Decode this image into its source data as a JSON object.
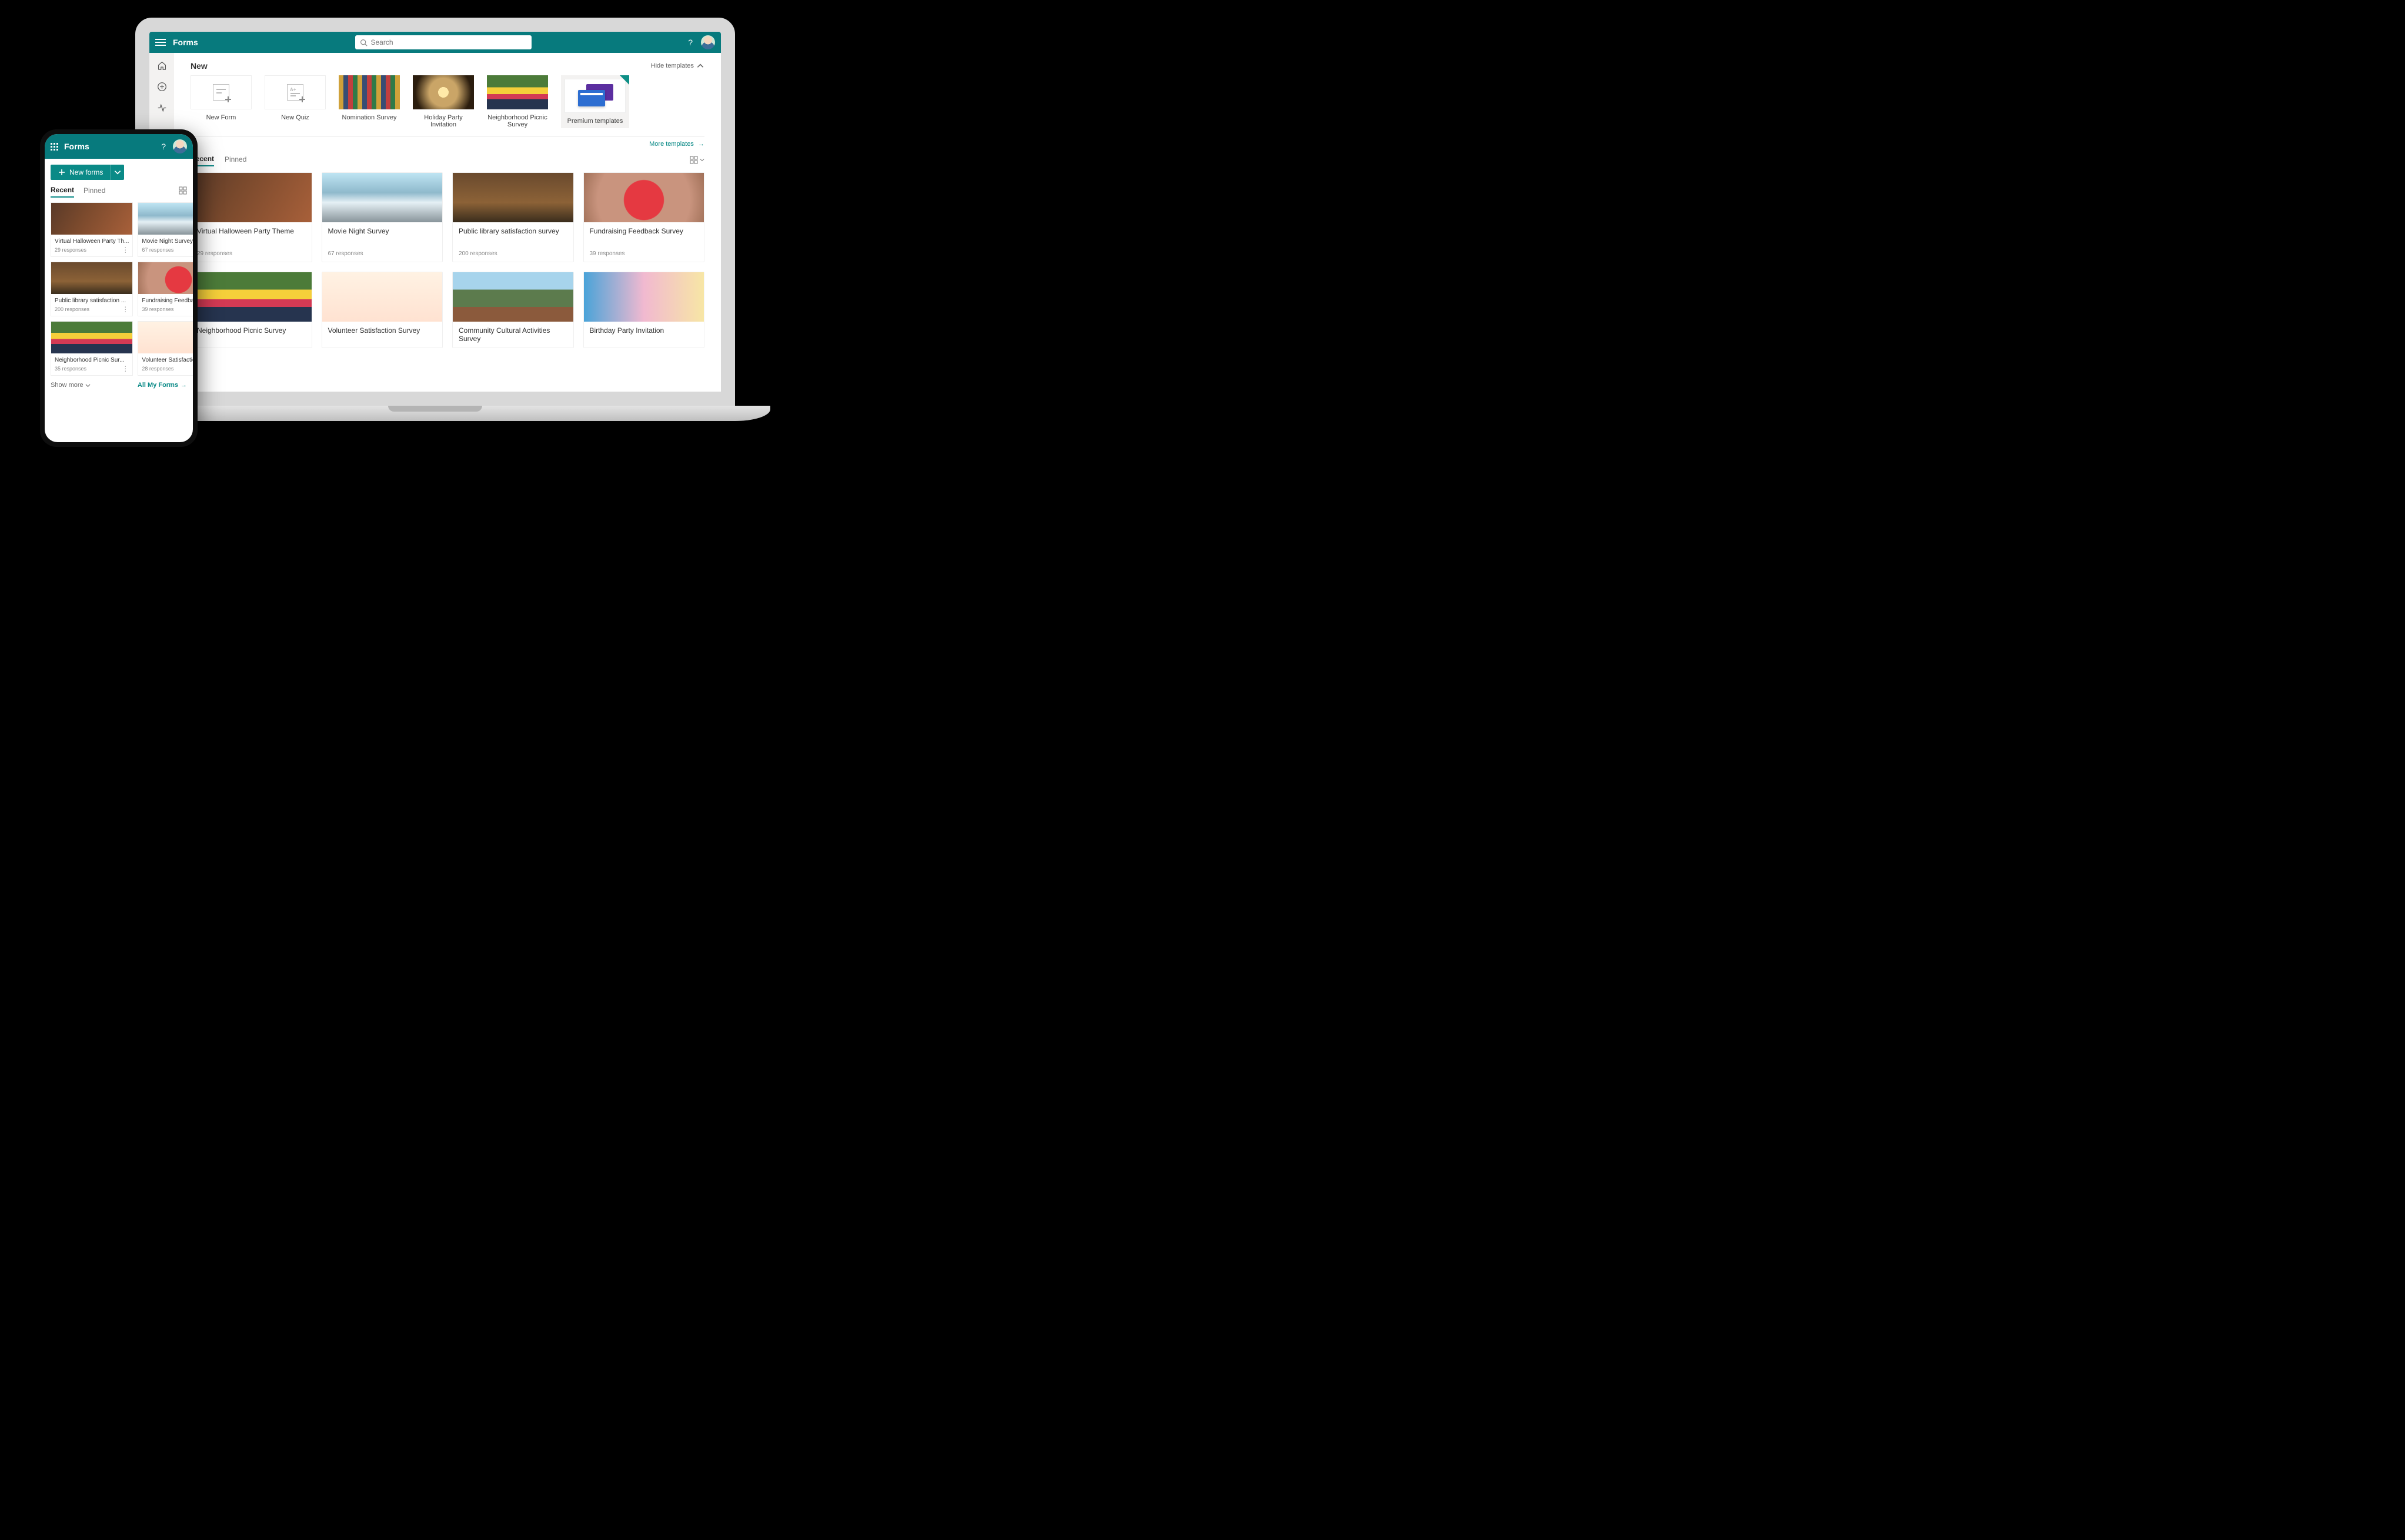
{
  "app_title": "Forms",
  "search": {
    "placeholder": "Search"
  },
  "desktop": {
    "new_section": "New",
    "hide_templates": "Hide templates",
    "templates": [
      {
        "label": "New Form",
        "kind": "new-form"
      },
      {
        "label": "New Quiz",
        "kind": "new-quiz"
      },
      {
        "label": "Nomination Survey",
        "kind": "image",
        "img": "img-pencils"
      },
      {
        "label": "Holiday Party Invitation",
        "kind": "image",
        "img": "img-sparkler"
      },
      {
        "label": "Neighborhood Picnic Survey",
        "kind": "image",
        "img": "img-picnic"
      },
      {
        "label": "Premium templates",
        "kind": "premium"
      }
    ],
    "more_templates": "More templates",
    "tabs": {
      "recent": "Recent",
      "pinned": "Pinned"
    },
    "recent_cards_row1": [
      {
        "title": "Virtual Halloween Party Theme",
        "meta": "29 responses",
        "img": "img-bunting"
      },
      {
        "title": "Movie Night Survey",
        "meta": "67 responses",
        "img": "img-mountain"
      },
      {
        "title": "Public library satisfaction survey",
        "meta": "200 responses",
        "img": "img-library"
      },
      {
        "title": "Fundraising Feedback Survey",
        "meta": "39 responses",
        "img": "img-heart"
      }
    ],
    "recent_cards_row2": [
      {
        "title": "Neighborhood Picnic Survey",
        "img": "img-picnic"
      },
      {
        "title": "Volunteer Satisfaction Survey",
        "img": "img-volunteer"
      },
      {
        "title": "Community Cultural Activities Survey",
        "img": "img-campus"
      },
      {
        "title": "Birthday Party Invitation",
        "img": "img-birthday"
      }
    ]
  },
  "phone": {
    "new_forms": "New forms",
    "tabs": {
      "recent": "Recent",
      "pinned": "Pinned"
    },
    "cards": [
      {
        "title": "Virtual Halloween Party Th...",
        "meta": "29 responses",
        "img": "img-bunting"
      },
      {
        "title": "Movie Night Survey",
        "meta": "67 responses",
        "img": "img-mountain"
      },
      {
        "title": "Public library satisfaction ...",
        "meta": "200 responses",
        "img": "img-library"
      },
      {
        "title": "Fundraising Feedback Sur...",
        "meta": "39 responses",
        "img": "img-heart"
      },
      {
        "title": "Neighborhood Picnic Sur...",
        "meta": "35 responses",
        "img": "img-picnic"
      },
      {
        "title": "Volunteer Satisfaction Sur...",
        "meta": "28 responses",
        "img": "img-volunteer"
      }
    ],
    "show_more": "Show more",
    "all_my_forms": "All My Forms"
  }
}
